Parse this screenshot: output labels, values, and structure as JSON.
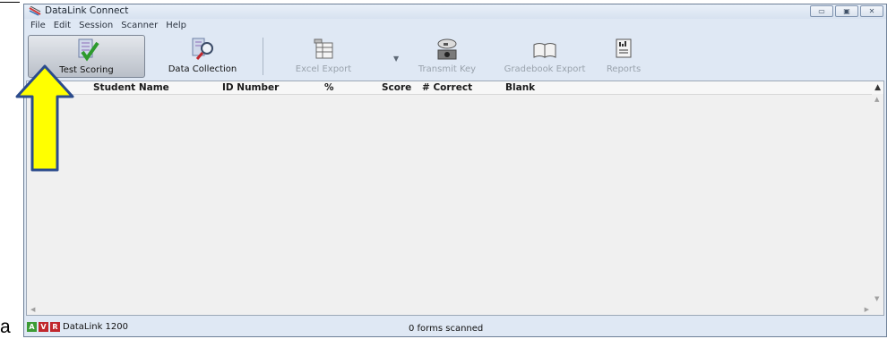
{
  "label": "a",
  "window": {
    "title": "DataLink Connect",
    "controls": {
      "minimize": "▭",
      "maximize": "▣",
      "close": "✕"
    }
  },
  "menu": [
    "File",
    "Edit",
    "Session",
    "Scanner",
    "Help"
  ],
  "toolbar": {
    "test_scoring": "Test Scoring",
    "data_collection": "Data Collection",
    "excel_export": "Excel Export",
    "transmit_key": "Transmit Key",
    "gradebook_export": "Gradebook Export",
    "reports": "Reports"
  },
  "grid": {
    "columns": [
      "Student Name",
      "ID Number",
      "%",
      "Score",
      "# Correct",
      "Blank"
    ]
  },
  "status": {
    "badges": [
      "A",
      "V",
      "R"
    ],
    "device": "DataLink 1200",
    "forms": "0 forms scanned"
  },
  "annotation": {
    "arrow_color": "#ffff00",
    "arrow_outline": "#2b4b8c"
  }
}
